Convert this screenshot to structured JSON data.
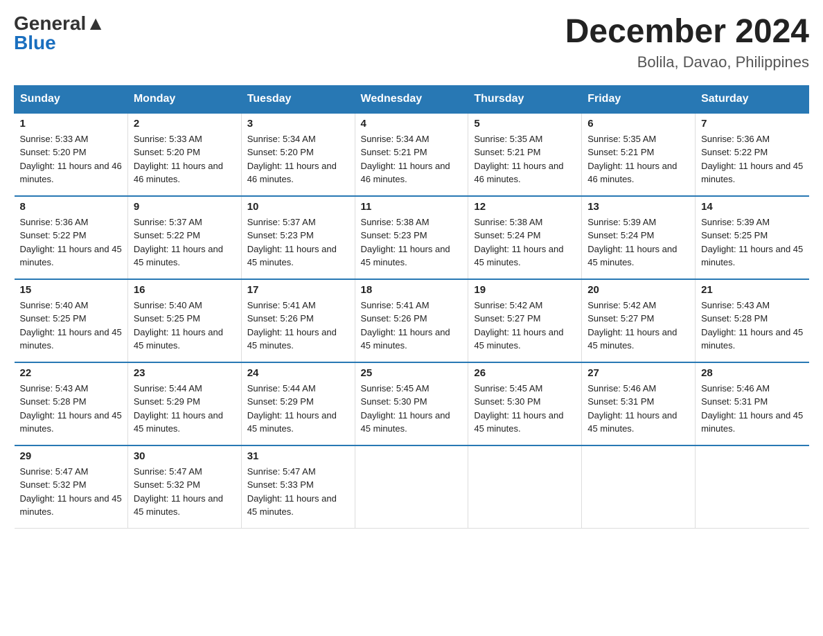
{
  "header": {
    "logo_general": "General",
    "logo_blue": "Blue",
    "month": "December 2024",
    "location": "Bolila, Davao, Philippines"
  },
  "weekdays": [
    "Sunday",
    "Monday",
    "Tuesday",
    "Wednesday",
    "Thursday",
    "Friday",
    "Saturday"
  ],
  "weeks": [
    [
      {
        "day": "1",
        "sunrise": "5:33 AM",
        "sunset": "5:20 PM",
        "daylight": "11 hours and 46 minutes."
      },
      {
        "day": "2",
        "sunrise": "5:33 AM",
        "sunset": "5:20 PM",
        "daylight": "11 hours and 46 minutes."
      },
      {
        "day": "3",
        "sunrise": "5:34 AM",
        "sunset": "5:20 PM",
        "daylight": "11 hours and 46 minutes."
      },
      {
        "day": "4",
        "sunrise": "5:34 AM",
        "sunset": "5:21 PM",
        "daylight": "11 hours and 46 minutes."
      },
      {
        "day": "5",
        "sunrise": "5:35 AM",
        "sunset": "5:21 PM",
        "daylight": "11 hours and 46 minutes."
      },
      {
        "day": "6",
        "sunrise": "5:35 AM",
        "sunset": "5:21 PM",
        "daylight": "11 hours and 46 minutes."
      },
      {
        "day": "7",
        "sunrise": "5:36 AM",
        "sunset": "5:22 PM",
        "daylight": "11 hours and 45 minutes."
      }
    ],
    [
      {
        "day": "8",
        "sunrise": "5:36 AM",
        "sunset": "5:22 PM",
        "daylight": "11 hours and 45 minutes."
      },
      {
        "day": "9",
        "sunrise": "5:37 AM",
        "sunset": "5:22 PM",
        "daylight": "11 hours and 45 minutes."
      },
      {
        "day": "10",
        "sunrise": "5:37 AM",
        "sunset": "5:23 PM",
        "daylight": "11 hours and 45 minutes."
      },
      {
        "day": "11",
        "sunrise": "5:38 AM",
        "sunset": "5:23 PM",
        "daylight": "11 hours and 45 minutes."
      },
      {
        "day": "12",
        "sunrise": "5:38 AM",
        "sunset": "5:24 PM",
        "daylight": "11 hours and 45 minutes."
      },
      {
        "day": "13",
        "sunrise": "5:39 AM",
        "sunset": "5:24 PM",
        "daylight": "11 hours and 45 minutes."
      },
      {
        "day": "14",
        "sunrise": "5:39 AM",
        "sunset": "5:25 PM",
        "daylight": "11 hours and 45 minutes."
      }
    ],
    [
      {
        "day": "15",
        "sunrise": "5:40 AM",
        "sunset": "5:25 PM",
        "daylight": "11 hours and 45 minutes."
      },
      {
        "day": "16",
        "sunrise": "5:40 AM",
        "sunset": "5:25 PM",
        "daylight": "11 hours and 45 minutes."
      },
      {
        "day": "17",
        "sunrise": "5:41 AM",
        "sunset": "5:26 PM",
        "daylight": "11 hours and 45 minutes."
      },
      {
        "day": "18",
        "sunrise": "5:41 AM",
        "sunset": "5:26 PM",
        "daylight": "11 hours and 45 minutes."
      },
      {
        "day": "19",
        "sunrise": "5:42 AM",
        "sunset": "5:27 PM",
        "daylight": "11 hours and 45 minutes."
      },
      {
        "day": "20",
        "sunrise": "5:42 AM",
        "sunset": "5:27 PM",
        "daylight": "11 hours and 45 minutes."
      },
      {
        "day": "21",
        "sunrise": "5:43 AM",
        "sunset": "5:28 PM",
        "daylight": "11 hours and 45 minutes."
      }
    ],
    [
      {
        "day": "22",
        "sunrise": "5:43 AM",
        "sunset": "5:28 PM",
        "daylight": "11 hours and 45 minutes."
      },
      {
        "day": "23",
        "sunrise": "5:44 AM",
        "sunset": "5:29 PM",
        "daylight": "11 hours and 45 minutes."
      },
      {
        "day": "24",
        "sunrise": "5:44 AM",
        "sunset": "5:29 PM",
        "daylight": "11 hours and 45 minutes."
      },
      {
        "day": "25",
        "sunrise": "5:45 AM",
        "sunset": "5:30 PM",
        "daylight": "11 hours and 45 minutes."
      },
      {
        "day": "26",
        "sunrise": "5:45 AM",
        "sunset": "5:30 PM",
        "daylight": "11 hours and 45 minutes."
      },
      {
        "day": "27",
        "sunrise": "5:46 AM",
        "sunset": "5:31 PM",
        "daylight": "11 hours and 45 minutes."
      },
      {
        "day": "28",
        "sunrise": "5:46 AM",
        "sunset": "5:31 PM",
        "daylight": "11 hours and 45 minutes."
      }
    ],
    [
      {
        "day": "29",
        "sunrise": "5:47 AM",
        "sunset": "5:32 PM",
        "daylight": "11 hours and 45 minutes."
      },
      {
        "day": "30",
        "sunrise": "5:47 AM",
        "sunset": "5:32 PM",
        "daylight": "11 hours and 45 minutes."
      },
      {
        "day": "31",
        "sunrise": "5:47 AM",
        "sunset": "5:33 PM",
        "daylight": "11 hours and 45 minutes."
      },
      null,
      null,
      null,
      null
    ]
  ],
  "labels": {
    "sunrise": "Sunrise:",
    "sunset": "Sunset:",
    "daylight": "Daylight:"
  }
}
